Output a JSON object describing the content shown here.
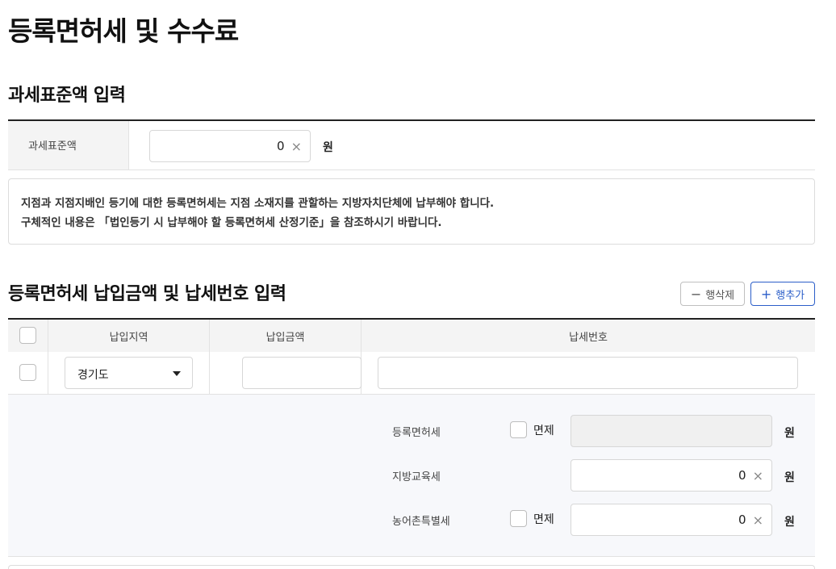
{
  "page": {
    "title": "등록면허세 및 수수료"
  },
  "base_section": {
    "title": "과세표준액 입력",
    "label": "과세표준액",
    "value": "0",
    "unit": "원"
  },
  "notice": {
    "line1": "지점과 지점지배인 등기에 대한 등록면허세는 지점 소재지를 관할하는 지방자치단체에 납부해야 합니다.",
    "line2": "구체적인 내용은 「법인등기 시 납부해야 할 등록면허세 산정기준」을 참조하시기 바랍니다."
  },
  "payment_section": {
    "title": "등록면허세 납입금액 및 납세번호 입력",
    "delete_label": "행삭제",
    "add_label": "행추가",
    "columns": [
      "납입지역",
      "납입금액",
      "납세번호"
    ],
    "row": {
      "region": "경기도",
      "amount": "",
      "tax_number": ""
    }
  },
  "taxes": [
    {
      "label": "등록면허세",
      "exempt_label": "면제",
      "value": "",
      "unit": "원"
    },
    {
      "label": "지방교육세",
      "value": "0",
      "unit": "원"
    },
    {
      "label": "농어촌특별세",
      "exempt_label": "면제",
      "value": "0",
      "unit": "원"
    }
  ],
  "icons": {
    "clear": "×",
    "minus": "−",
    "plus": "+"
  }
}
